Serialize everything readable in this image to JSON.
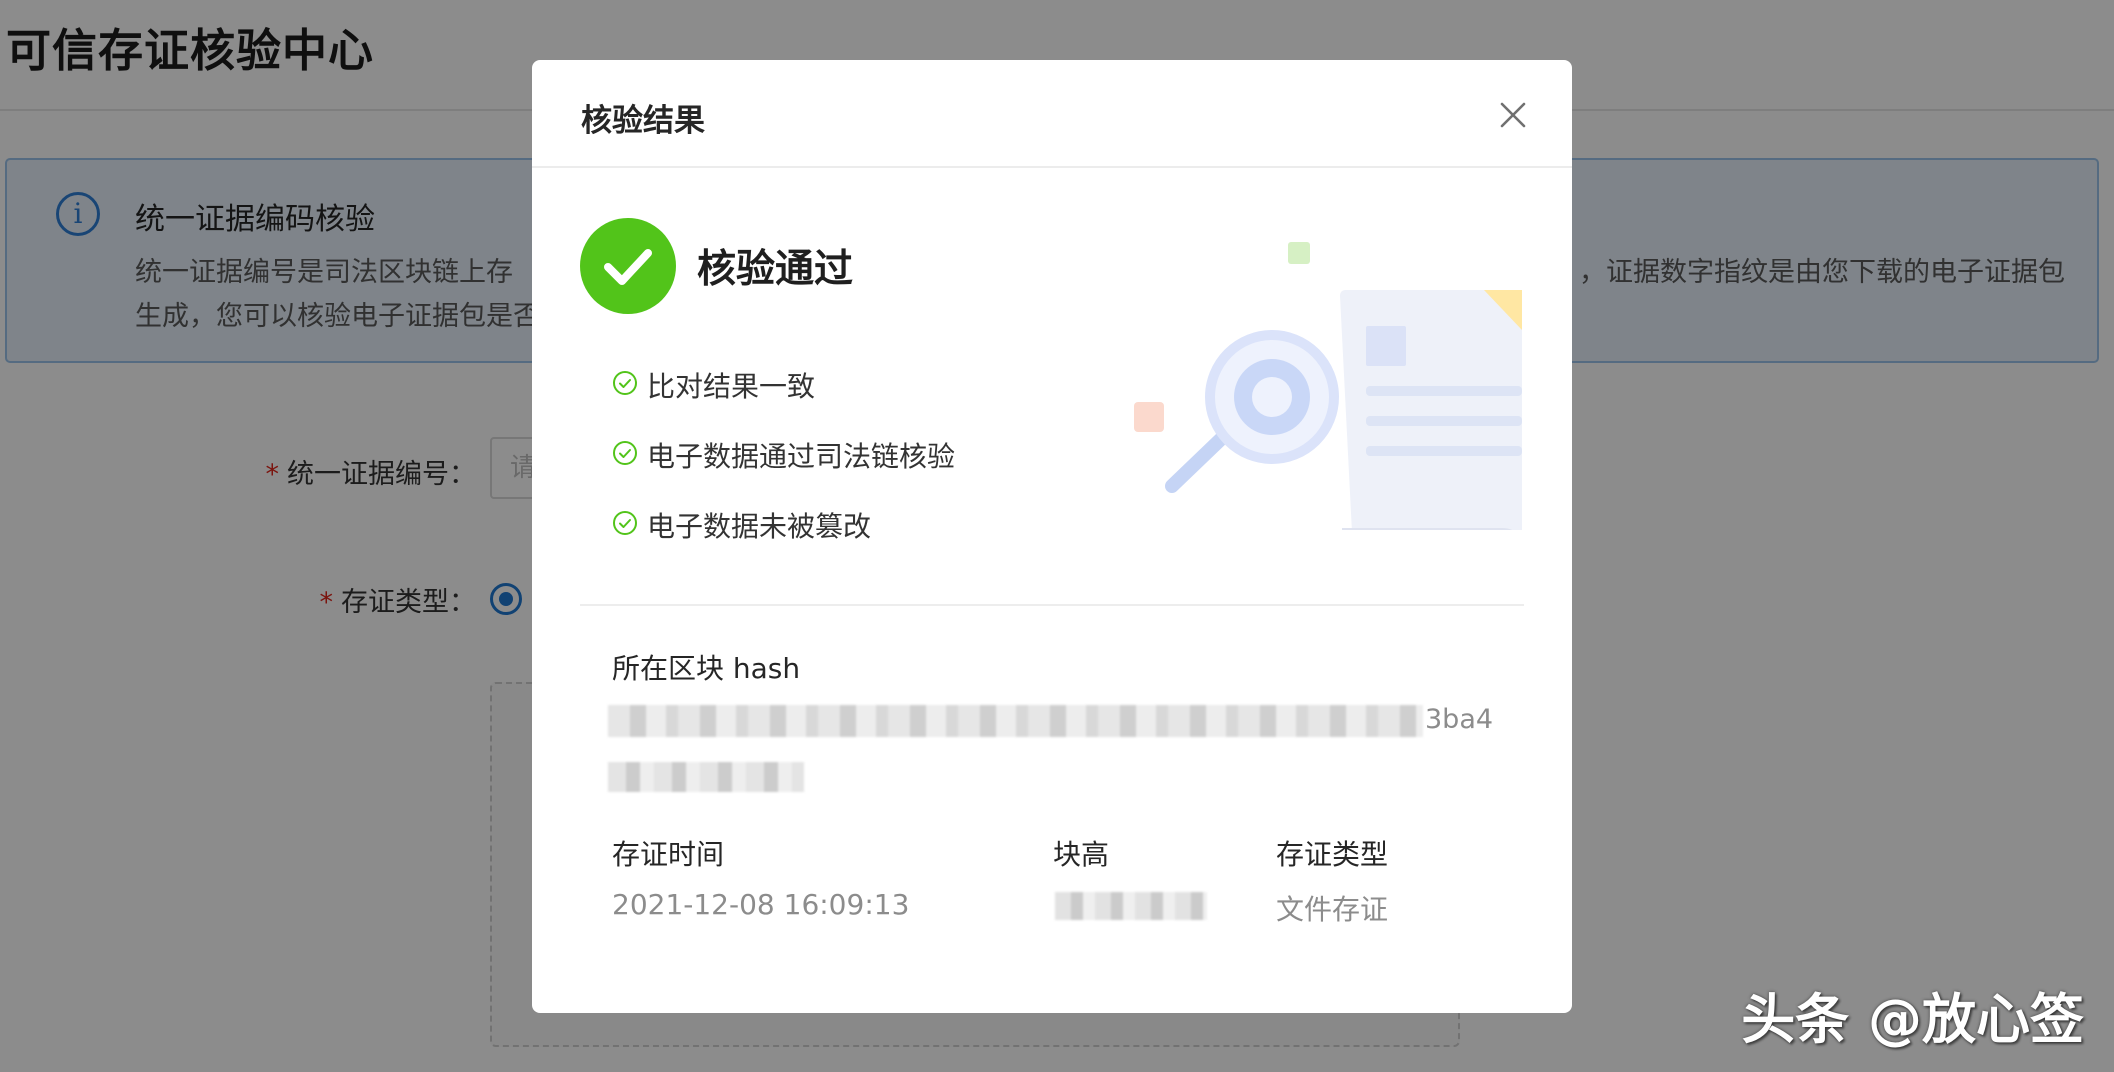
{
  "page": {
    "title": "可信存证核验中心",
    "info": {
      "icon": "info-icon",
      "title": "统一证据编码核验",
      "line1": "统一证据编号是司法区块链上存",
      "line1_right": "，证据数字指纹是由您下载的电子证据包",
      "line2": "生成，您可以核验电子证据包是否"
    },
    "form": {
      "evidence_number_label": "统一证据编号：",
      "evidence_number_placeholder": "请",
      "deposit_type_label": "存证类型："
    }
  },
  "modal": {
    "title": "核验结果",
    "close_icon": "close-icon",
    "status": "核验通过",
    "status_icon": "check-circle-icon",
    "checks": [
      "比对结果一致",
      "电子数据通过司法链核验",
      "电子数据未被篡改"
    ],
    "hash_label": "所在区块 hash",
    "hash_visible_tail": "3ba4",
    "time_label": "存证时间",
    "time_value": "2021-12-08 16:09:13",
    "height_label": "块高",
    "type_label": "存证类型",
    "type_value": "文件存证"
  },
  "watermark": "头条 @放心签",
  "colors": {
    "success": "#52c41a",
    "primary": "#1f78d1",
    "required": "#e1251b",
    "info_bg": "#e7f1fb"
  }
}
